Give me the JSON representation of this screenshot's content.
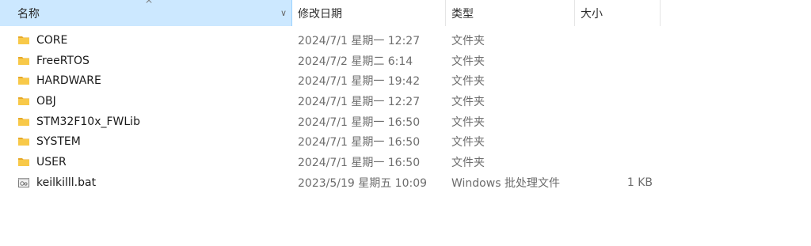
{
  "header": {
    "columns": {
      "name": "名称",
      "date": "修改日期",
      "type": "类型",
      "size": "大小"
    },
    "sort_indicator": "^",
    "dropdown_glyph": "∨"
  },
  "files": [
    {
      "name": "CORE",
      "date": "2024/7/1 星期一 12:27",
      "type": "文件夹",
      "size": "",
      "icon": "folder-icon"
    },
    {
      "name": "FreeRTOS",
      "date": "2024/7/2 星期二 6:14",
      "type": "文件夹",
      "size": "",
      "icon": "folder-icon"
    },
    {
      "name": "HARDWARE",
      "date": "2024/7/1 星期一 19:42",
      "type": "文件夹",
      "size": "",
      "icon": "folder-icon"
    },
    {
      "name": "OBJ",
      "date": "2024/7/1 星期一 12:27",
      "type": "文件夹",
      "size": "",
      "icon": "folder-icon"
    },
    {
      "name": "STM32F10x_FWLib",
      "date": "2024/7/1 星期一 16:50",
      "type": "文件夹",
      "size": "",
      "icon": "folder-icon"
    },
    {
      "name": "SYSTEM",
      "date": "2024/7/1 星期一 16:50",
      "type": "文件夹",
      "size": "",
      "icon": "folder-icon"
    },
    {
      "name": "USER",
      "date": "2024/7/1 星期一 16:50",
      "type": "文件夹",
      "size": "",
      "icon": "folder-icon"
    },
    {
      "name": "keilkilll.bat",
      "date": "2023/5/19 星期五 10:09",
      "type": "Windows 批处理文件",
      "size": "1 KB",
      "icon": "batch-file-icon"
    }
  ],
  "colors": {
    "header_selected_bg": "#cce8ff",
    "folder_yellow": "#f8c949",
    "folder_dark": "#e7a928"
  }
}
